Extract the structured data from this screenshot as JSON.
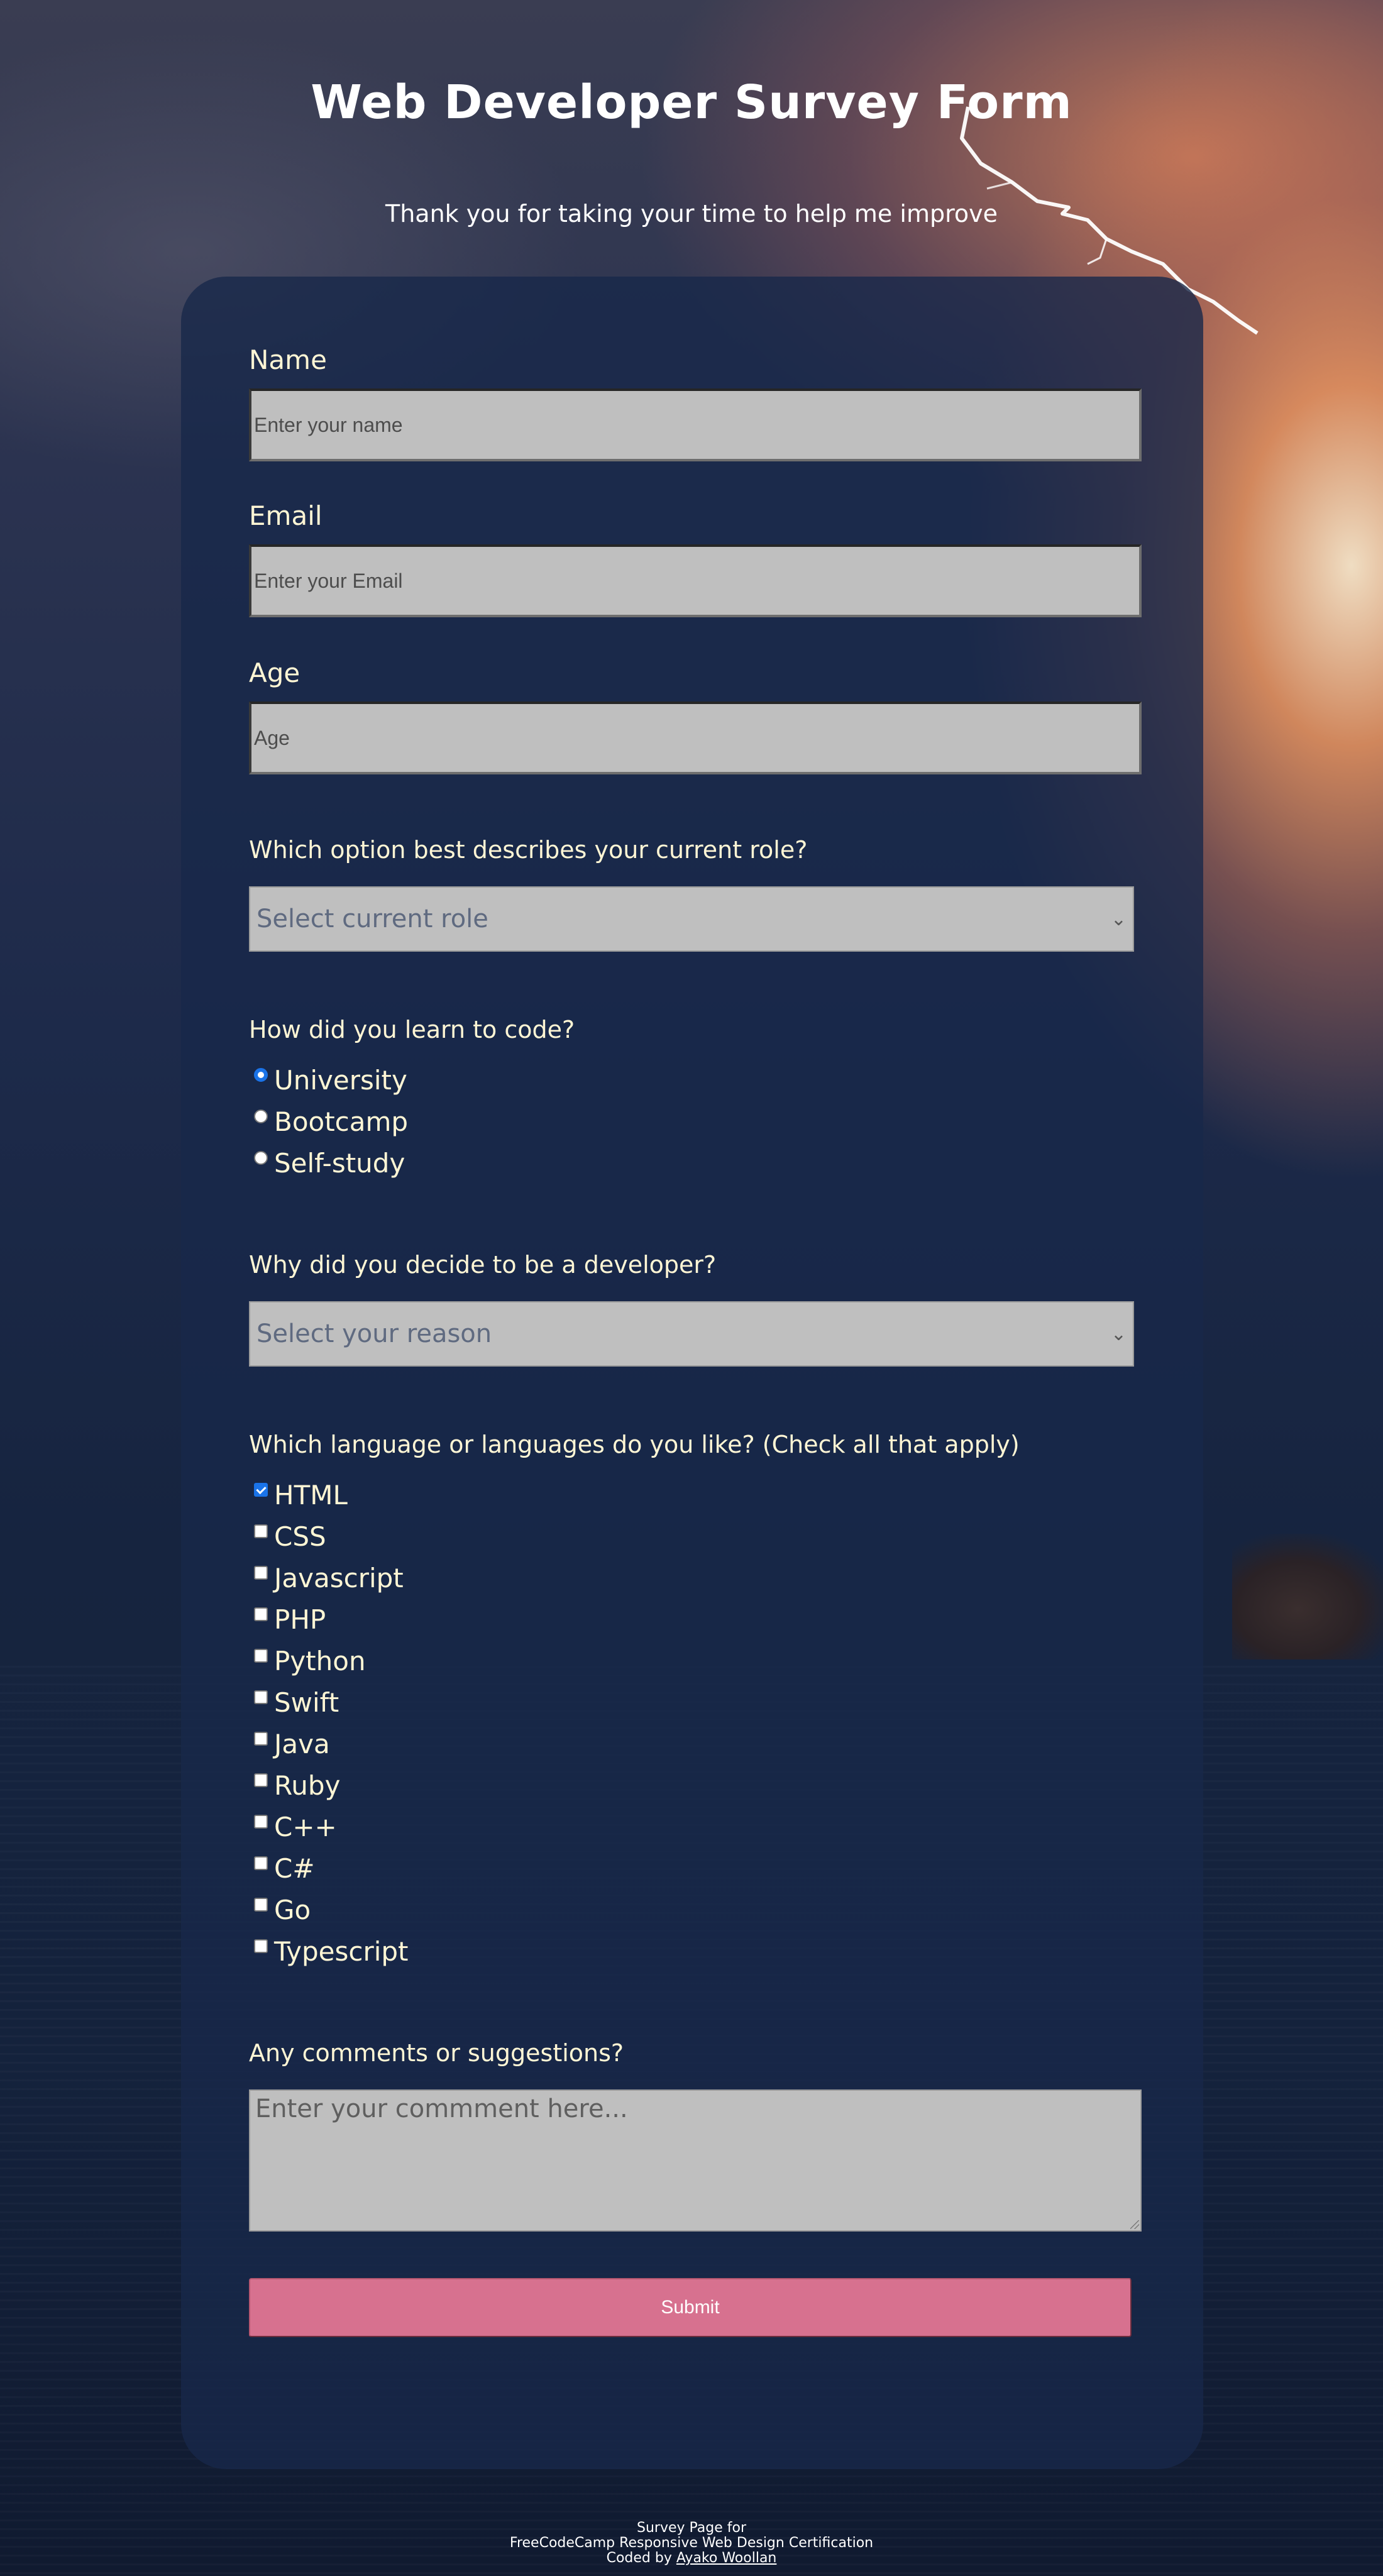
{
  "header": {
    "title": "Web Developer Survey Form",
    "description": "Thank you for taking your time to help me improve"
  },
  "form": {
    "name": {
      "label": "Name",
      "placeholder": "Enter your name"
    },
    "email": {
      "label": "Email",
      "placeholder": "Enter your Email"
    },
    "age": {
      "label": "Age",
      "placeholder": "Age"
    },
    "role": {
      "question": "Which option best describes your current role?",
      "selected": "Select current role"
    },
    "learn": {
      "question": "How did you learn to code?",
      "options": [
        "University",
        "Bootcamp",
        "Self-study"
      ],
      "selected": "University"
    },
    "reason": {
      "question": "Why did you decide to be a developer?",
      "selected": "Select your reason"
    },
    "languages": {
      "question": "Which language or languages do you like? (Check all that apply)",
      "options": [
        "HTML",
        "CSS",
        "Javascript",
        "PHP",
        "Python",
        "Swift",
        "Java",
        "Ruby",
        "C++",
        "C#",
        "Go",
        "Typescript"
      ],
      "checked": [
        "HTML"
      ]
    },
    "comments": {
      "question": "Any comments or suggestions?",
      "placeholder": "Enter your commment here..."
    },
    "submit_label": "Submit"
  },
  "footer": {
    "line1": "Survey Page for",
    "line2": "FreeCodeCamp Responsive Web Design Certification",
    "line3_prefix": "Coded by ",
    "author": "Ayako Woollan"
  },
  "colors": {
    "label_text": "#fff6d5",
    "card_bg": "#18284a",
    "input_bg": "#bfbfbf",
    "submit_bg": "#d7718f",
    "accent": "#1a73e8"
  },
  "icons": [
    "chevron-down-icon",
    "radio-icon",
    "checkbox-icon",
    "resize-grip-icon"
  ]
}
